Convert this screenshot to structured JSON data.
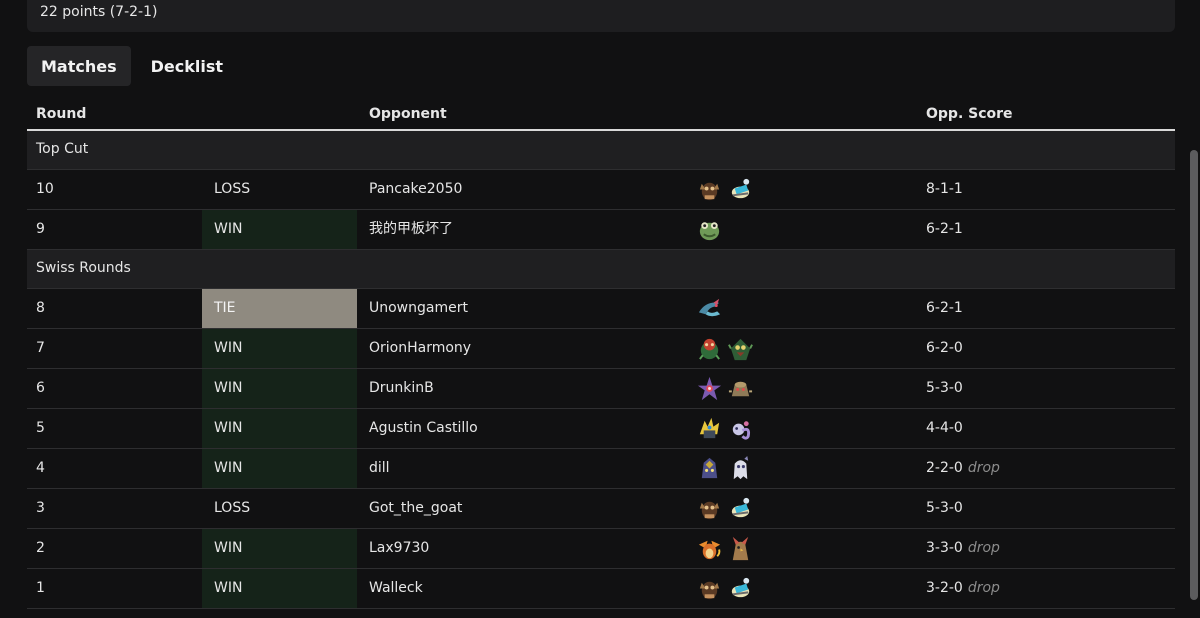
{
  "summary": {
    "points_text": "22 points (7-2-1)"
  },
  "tabs": [
    {
      "label": "Matches"
    },
    {
      "label": "Decklist"
    }
  ],
  "table": {
    "headers": {
      "round": "Round",
      "opponent": "Opponent",
      "opp_score": "Opp. Score"
    },
    "sections": [
      {
        "title": "Top Cut",
        "rows": [
          {
            "round": "10",
            "result": "LOSS",
            "opponent": "Pancake2050",
            "score": "8-1-1",
            "drop": "",
            "deck": [
              "ogerpon-hearthflame-icon",
              "dusknoir-mask-icon"
            ]
          },
          {
            "round": "9",
            "result": "WIN",
            "opponent": "我的甲板坏了",
            "score": "6-2-1",
            "drop": "",
            "deck": [
              "toxicroak-frog-icon"
            ]
          }
        ]
      },
      {
        "title": "Swiss Rounds",
        "rows": [
          {
            "round": "8",
            "result": "TIE",
            "opponent": "Unowngamert",
            "score": "6-2-1",
            "drop": "",
            "deck": [
              "dragapult-icon"
            ]
          },
          {
            "round": "7",
            "result": "WIN",
            "opponent": "OrionHarmony",
            "score": "6-2-0",
            "drop": "",
            "deck": [
              "ogerpon-teal-icon",
              "decidueye-icon"
            ]
          },
          {
            "round": "6",
            "result": "WIN",
            "opponent": "DrunkinB",
            "score": "5-3-0",
            "drop": "",
            "deck": [
              "starmie-icon",
              "bronzong-icon"
            ]
          },
          {
            "round": "5",
            "result": "WIN",
            "opponent": "Agustin Castillo",
            "score": "4-4-0",
            "drop": "",
            "deck": [
              "iron-thorns-icon",
              "mew-icon"
            ]
          },
          {
            "round": "4",
            "result": "WIN",
            "opponent": "dill",
            "score": "2-2-0",
            "drop": "drop",
            "deck": [
              "gholdengo-dark-icon",
              "mimikyu-icon"
            ]
          },
          {
            "round": "3",
            "result": "LOSS",
            "opponent": "Got_the_goat",
            "score": "5-3-0",
            "drop": "",
            "deck": [
              "ogerpon-hearthflame-icon",
              "dusknoir-mask-icon"
            ]
          },
          {
            "round": "2",
            "result": "WIN",
            "opponent": "Lax9730",
            "score": "3-3-0",
            "drop": "drop",
            "deck": [
              "charizard-icon",
              "pidgeot-icon"
            ]
          },
          {
            "round": "1",
            "result": "WIN",
            "opponent": "Walleck",
            "score": "3-2-0",
            "drop": "drop",
            "deck": [
              "ogerpon-hearthflame-icon",
              "dusknoir-mask-icon"
            ]
          }
        ]
      }
    ]
  },
  "colors": {
    "background": "#111112",
    "win_cell": "#152319",
    "tie_cell": "#8f8a80",
    "header_rule": "#d9d9d9"
  }
}
